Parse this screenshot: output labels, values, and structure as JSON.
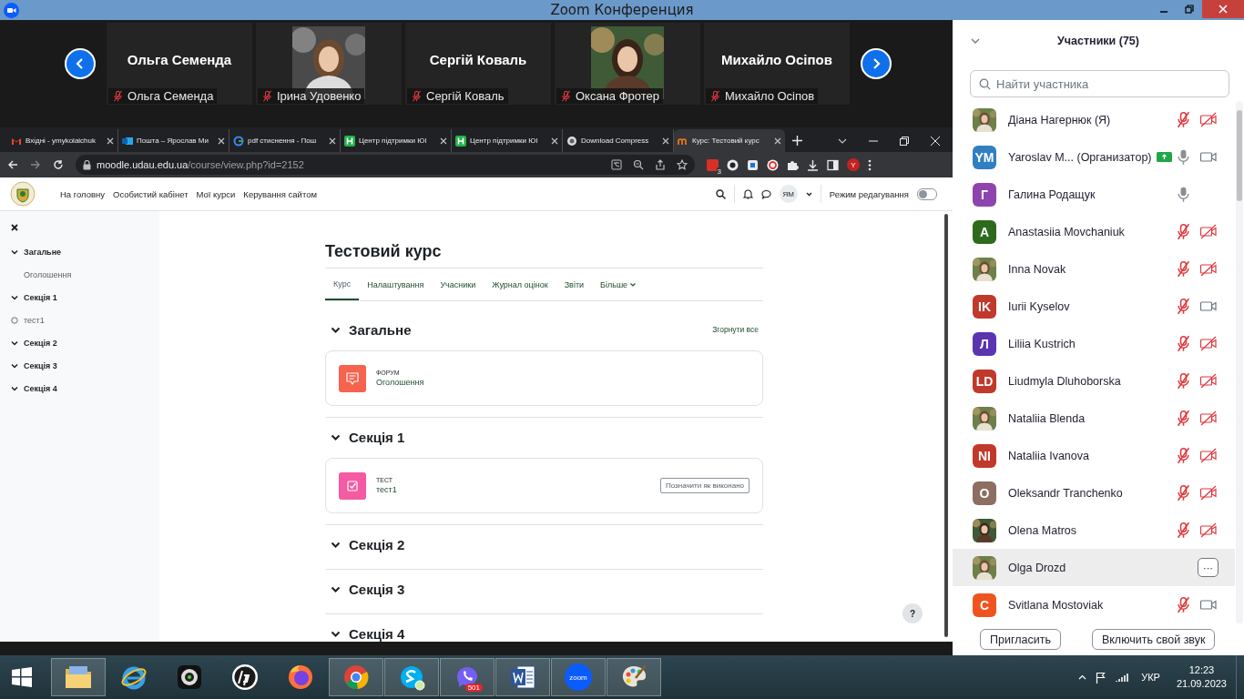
{
  "window": {
    "title": "Zoom Конференция"
  },
  "video_strip": {
    "tiles": [
      {
        "kind": "name",
        "name": "Ольга Семенда",
        "label": "Ольга Семенда",
        "muted": true
      },
      {
        "kind": "picture",
        "label": "Ірина Удовенко",
        "muted": true
      },
      {
        "kind": "name",
        "name": "Сергій Коваль",
        "label": "Сергій Коваль",
        "muted": true
      },
      {
        "kind": "picture",
        "label": "Оксана Фротер",
        "muted": true
      },
      {
        "kind": "name",
        "name": "Михайло Осіпов",
        "label": "Михайло Осіпов",
        "muted": true
      }
    ]
  },
  "browser": {
    "tabs": [
      {
        "kind": "gmail",
        "title": "Вхідні - ymykolaichuk",
        "selected": false
      },
      {
        "kind": "outlook",
        "title": "Пошта – Ярослав Ми",
        "selected": false
      },
      {
        "kind": "google",
        "title": "pdf стиснення - Пош",
        "selected": false
      },
      {
        "kind": "h",
        "title": "Центр підтримки ЮІ",
        "selected": false
      },
      {
        "kind": "h",
        "title": "Центр підтримки ЮІ",
        "selected": false
      },
      {
        "kind": "globe",
        "title": "Download Compress",
        "selected": false
      },
      {
        "kind": "moodle",
        "title": "Курс: Тестовий курс",
        "selected": true
      }
    ],
    "address": {
      "host": "moodle.udau.edu.ua",
      "path": "/course/view.php?id=2152"
    },
    "extension_badge": "3",
    "profile": "Y"
  },
  "moodle": {
    "nav": [
      "На головну",
      "Особистий кабінет",
      "Мої курси",
      "Керування сайтом"
    ],
    "user_initials": "ЯМ",
    "edit_mode": {
      "label": "Режим редагування",
      "on": false
    },
    "help": "?"
  },
  "course_index": [
    {
      "title": "Загальне",
      "expanded": true,
      "children": [
        {
          "title": "Оголошення",
          "tracked": false
        }
      ]
    },
    {
      "title": "Секція 1",
      "expanded": true,
      "children": [
        {
          "title": "тест1",
          "tracked": true
        }
      ]
    },
    {
      "title": "Секція 2",
      "expanded": true
    },
    {
      "title": "Секція 3",
      "expanded": true
    },
    {
      "title": "Секція 4",
      "expanded": true
    }
  ],
  "course": {
    "title": "Тестовий курс",
    "collapse_all": "Згорнути все",
    "tabs": [
      {
        "label": "Курс",
        "selected": true,
        "dropdown": false
      },
      {
        "label": "Налаштування",
        "selected": false,
        "dropdown": false
      },
      {
        "label": "Учасники",
        "selected": false,
        "dropdown": false
      },
      {
        "label": "Журнал оцінок",
        "selected": false,
        "dropdown": false
      },
      {
        "label": "Звіти",
        "selected": false,
        "dropdown": false
      },
      {
        "label": "Більше",
        "selected": false,
        "dropdown": true
      }
    ],
    "sections": [
      {
        "title": "Загальне",
        "expanded": true,
        "activities": [
          {
            "kind": "forum",
            "type": "ФОРУМ",
            "name": "Оголошення"
          }
        ]
      },
      {
        "title": "Секція 1",
        "expanded": true,
        "activities": [
          {
            "kind": "quiz",
            "type": "ТЕСТ",
            "name": "тест1",
            "completion_button": "Позначити як виконано"
          }
        ]
      },
      {
        "title": "Секція 2",
        "expanded": true
      },
      {
        "title": "Секція 3",
        "expanded": true
      },
      {
        "title": "Секція 4",
        "expanded": true
      }
    ]
  },
  "participants": {
    "title": "Участники (75)",
    "search": {
      "placeholder": "Найти участника"
    },
    "list": [
      {
        "name": "Діана Нагернюк (Я)",
        "kind": "av",
        "muted": true,
        "video_on": false,
        "badge": false,
        "selected": false
      },
      {
        "name": "Yaroslav M...  (Организатор)",
        "avatar": {
          "kind": "initials",
          "initials": "YM",
          "color": "#2f7fc1"
        },
        "kind": "av",
        "muted": false,
        "video_on": true,
        "badge": true,
        "selected": false
      },
      {
        "name": "Галина Родащук",
        "avatar": {
          "kind": "initials",
          "initials": "Г",
          "color": "#8e44ad"
        },
        "kind": "audio",
        "muted": false,
        "badge": false,
        "selected": false
      },
      {
        "name": "Anastasiia Movchaniuk",
        "avatar": {
          "kind": "initials",
          "initials": "A",
          "color": "#2e6a1e"
        },
        "kind": "av",
        "muted": true,
        "video_on": false,
        "badge": false,
        "selected": false
      },
      {
        "name": "Inna Novak",
        "kind": "av",
        "muted": true,
        "video_on": false,
        "badge": false,
        "selected": false
      },
      {
        "name": "Iurii Kyselov",
        "avatar": {
          "kind": "initials",
          "initials": "IK",
          "color": "#c0392b"
        },
        "kind": "av",
        "muted": true,
        "video_on": true,
        "badge": false,
        "selected": false
      },
      {
        "name": "Liliia Kustrich",
        "avatar": {
          "kind": "initials",
          "initials": "Л",
          "color": "#5b34b0"
        },
        "kind": "av",
        "muted": true,
        "video_on": false,
        "badge": false,
        "selected": false
      },
      {
        "name": "Liudmyla Dluhoborska",
        "avatar": {
          "kind": "initials",
          "initials": "LD",
          "color": "#c0392b"
        },
        "kind": "av",
        "muted": true,
        "video_on": false,
        "badge": false,
        "selected": false
      },
      {
        "name": "Nataliia Blenda",
        "kind": "av",
        "muted": true,
        "video_on": false,
        "badge": false,
        "selected": false
      },
      {
        "name": "Nataliia Ivanova",
        "avatar": {
          "kind": "initials",
          "initials": "NI",
          "color": "#c0392b"
        },
        "kind": "av",
        "muted": true,
        "video_on": false,
        "badge": false,
        "selected": false
      },
      {
        "name": "Oleksandr Tranchenko",
        "avatar": {
          "kind": "initials",
          "initials": "O",
          "color": "#8d6e63"
        },
        "kind": "av",
        "muted": true,
        "video_on": false,
        "badge": false,
        "selected": false
      },
      {
        "name": "Olena Matros",
        "kind": "av",
        "muted": true,
        "video_on": false,
        "badge": false,
        "selected": false
      },
      {
        "name": "Olga Drozd",
        "kind": "menu",
        "more": "···",
        "badge": false,
        "selected": true
      },
      {
        "name": "Svitlana Mostoviak",
        "avatar": {
          "kind": "initials",
          "initials": "C",
          "color": "#f0541e"
        },
        "kind": "av",
        "muted": true,
        "video_on": true,
        "badge": false,
        "selected": false
      }
    ],
    "buttons": [
      "Пригласить",
      "Включить свой звук"
    ]
  },
  "taskbar": {
    "apps": [
      {
        "kind": "explorer",
        "running": true
      },
      {
        "kind": "ie",
        "running": false
      },
      {
        "kind": "camera",
        "running": false
      },
      {
        "kind": "hp",
        "running": false
      },
      {
        "kind": "firefox",
        "running": false
      },
      {
        "kind": "chrome",
        "running": true
      },
      {
        "kind": "skype",
        "running": true
      },
      {
        "kind": "viber",
        "running": true,
        "badge": "501"
      },
      {
        "kind": "word",
        "running": true
      },
      {
        "kind": "zoom",
        "running": true,
        "label": "zoom"
      },
      {
        "kind": "paint",
        "running": true
      }
    ],
    "tray": {
      "language": "УКР",
      "time": "12:23",
      "date": "21.09.2023"
    }
  }
}
